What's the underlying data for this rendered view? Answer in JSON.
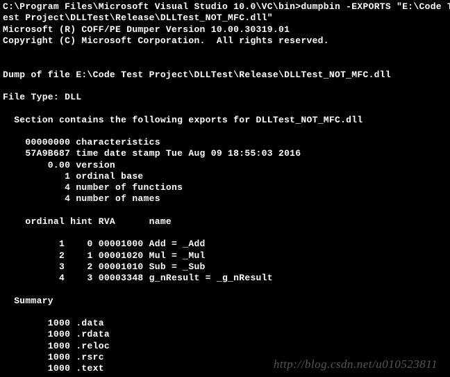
{
  "prompt": {
    "cwd": "C:\\Program Files\\Microsoft Visual Studio 10.0\\VC\\bin>",
    "command_l1": "dumpbin -EXPORTS \"E:\\Code T",
    "command_l2": "est Project\\DLLTest\\Release\\DLLTest_NOT_MFC.dll\""
  },
  "header": {
    "product": "Microsoft (R) COFF/PE Dumper Version 10.00.30319.01",
    "copyright": "Copyright (C) Microsoft Corporation.  All rights reserved."
  },
  "dump": {
    "title": "Dump of file E:\\Code Test Project\\DLLTest\\Release\\DLLTest_NOT_MFC.dll",
    "filetype": "File Type: DLL",
    "section_header": "  Section contains the following exports for DLLTest_NOT_MFC.dll",
    "characteristics": "    00000000 characteristics",
    "timedatestamp": "    57A9B687 time date stamp Tue Aug 09 18:55:03 2016",
    "version": "        0.00 version",
    "ordinal_base": "           1 ordinal base",
    "num_functions": "           4 number of functions",
    "num_names": "           4 number of names",
    "table_header": "    ordinal hint RVA      name",
    "row1": "          1    0 00001000 Add = _Add",
    "row2": "          2    1 00001020 Mul = _Mul",
    "row3": "          3    2 00001010 Sub = _Sub",
    "row4": "          4    3 00003348 g_nResult = _g_nResult"
  },
  "summary": {
    "title": "  Summary",
    "r1": "        1000 .data",
    "r2": "        1000 .rdata",
    "r3": "        1000 .reloc",
    "r4": "        1000 .rsrc",
    "r5": "        1000 .text"
  },
  "watermark": "http://blog.csdn.net/u010523811"
}
